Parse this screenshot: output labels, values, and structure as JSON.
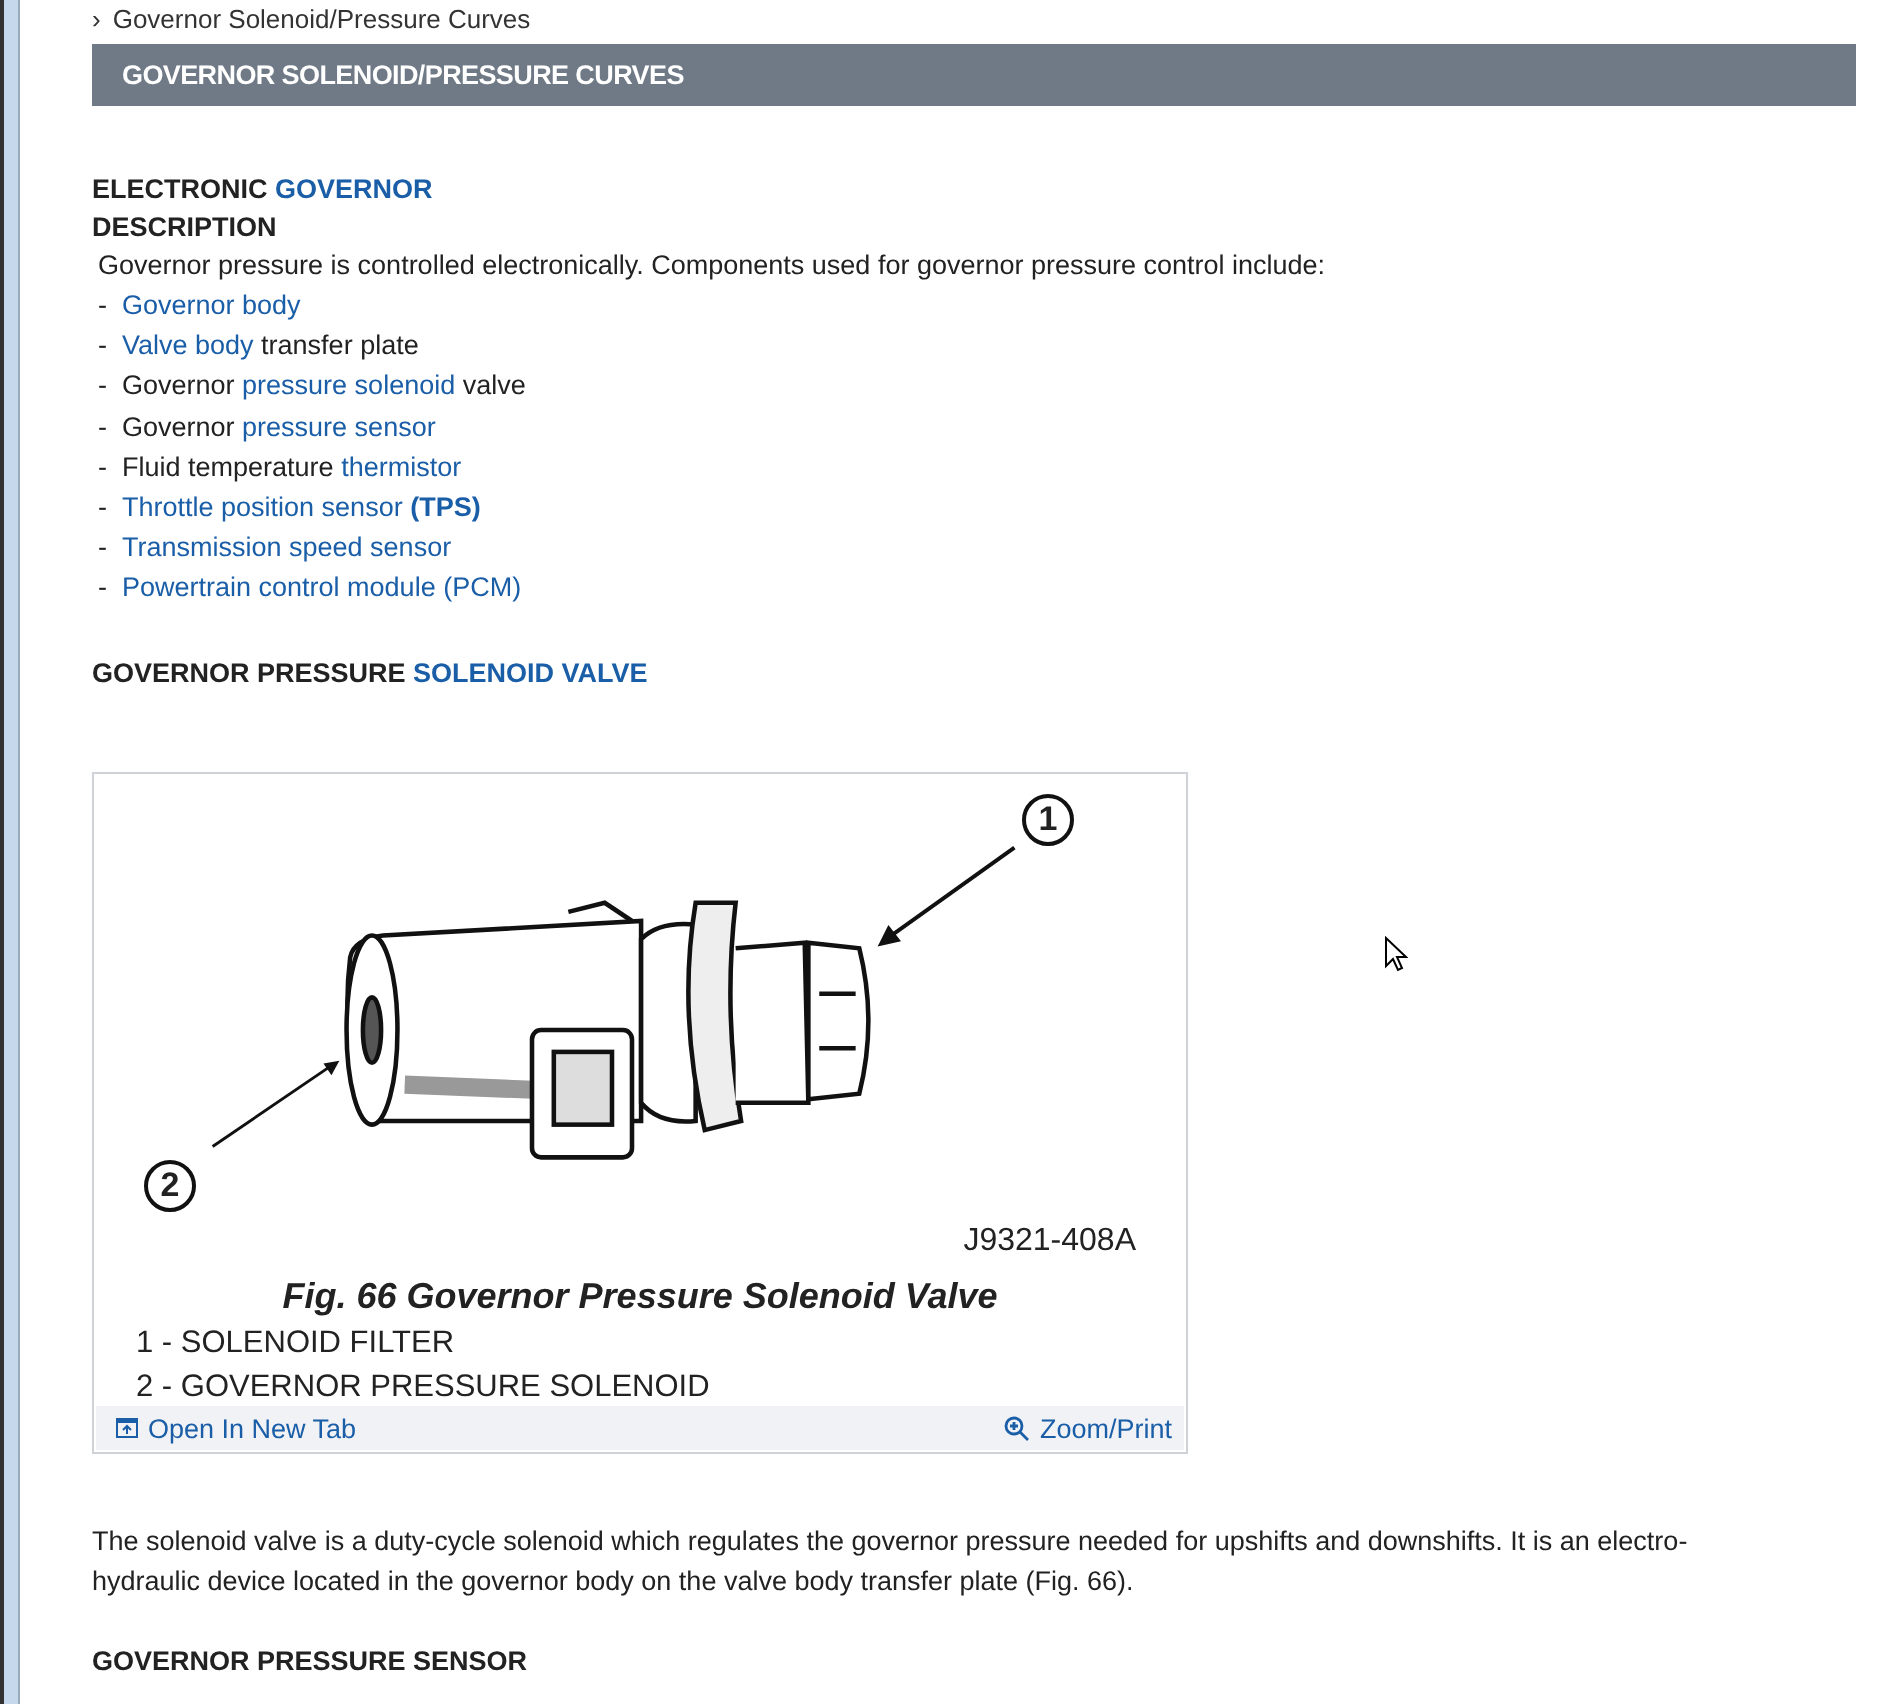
{
  "breadcrumb": {
    "chevron": "›",
    "label": "Governor Solenoid/Pressure Curves"
  },
  "section_header": "GOVERNOR SOLENOID/PRESSURE CURVES",
  "heading": [
    {
      "text": "ELECTRONIC ",
      "link": false
    },
    {
      "text": "GOVERNOR",
      "link": true
    }
  ],
  "subheading": "DESCRIPTION",
  "intro": "Governor pressure is controlled electronically. Components used for governor pressure control include:",
  "components": [
    {
      "bullet": "-",
      "parts": [
        {
          "text": "Governor body",
          "link": true
        }
      ]
    },
    {
      "bullet": "-",
      "parts": [
        {
          "text": "Valve body",
          "link": true
        },
        {
          "text": " transfer plate",
          "link": false
        }
      ]
    },
    {
      "bullet": "-",
      "parts": [
        {
          "text": "Governor ",
          "link": false
        },
        {
          "text": "pressure solenoid",
          "link": true
        },
        {
          "text": " valve",
          "link": false
        }
      ]
    },
    {
      "bullet": "-",
      "parts": [
        {
          "text": "Governor ",
          "link": false
        },
        {
          "text": "pressure sensor",
          "link": true
        }
      ]
    },
    {
      "bullet": "-",
      "parts": [
        {
          "text": "Fluid temperature ",
          "link": false
        },
        {
          "text": "thermistor",
          "link": true
        }
      ]
    },
    {
      "bullet": "-",
      "parts": [
        {
          "text": "Throttle position sensor",
          "link": true
        },
        {
          "text": " **(TPS)**",
          "link": true
        }
      ]
    },
    {
      "bullet": "-",
      "parts": [
        {
          "text": "Transmission speed sensor",
          "link": true
        }
      ]
    },
    {
      "bullet": "-",
      "parts": [
        {
          "text": "Powertrain control module (PCM)",
          "link": true
        }
      ]
    }
  ],
  "section2_heading": [
    {
      "text": "GOVERNOR PRESSURE ",
      "link": false
    },
    {
      "text": "SOLENOID VALVE",
      "link": true
    }
  ],
  "figure": {
    "callouts": [
      "1",
      "2"
    ],
    "code": "J9321-408A",
    "caption": "Fig. 66 Governor Pressure Solenoid Valve",
    "legend": [
      "1 - SOLENOID FILTER",
      "2 - GOVERNOR PRESSURE SOLENOID"
    ],
    "open_tab": "Open In New Tab",
    "zoom": "Zoom/Print"
  },
  "body_text": "The solenoid valve is a duty-cycle solenoid which regulates the governor pressure needed for upshifts and downshifts. It is an electro-hydraulic device located in the governor body on the valve body transfer plate (Fig. 66).",
  "next_heading": "GOVERNOR PRESSURE SENSOR"
}
